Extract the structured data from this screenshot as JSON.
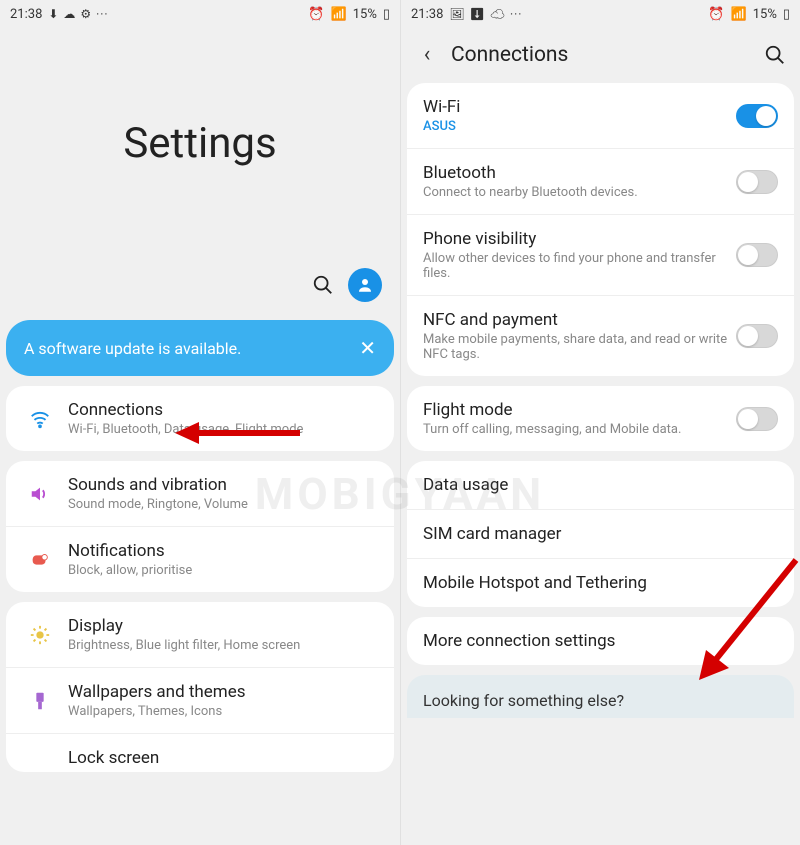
{
  "status": {
    "time": "21:38",
    "battery": "15%",
    "left_icons": "⬇ ☁ ⚙ ···",
    "right_icons_alarm": "⏰",
    "right_icons_wifi_sig": "📶"
  },
  "left": {
    "hero": "Settings",
    "banner": "A software update is available.",
    "items": [
      {
        "title": "Connections",
        "sub": "Wi-Fi, Bluetooth, Data usage, Flight mode"
      },
      {
        "title": "Sounds and vibration",
        "sub": "Sound mode, Ringtone, Volume"
      },
      {
        "title": "Notifications",
        "sub": "Block, allow, prioritise"
      },
      {
        "title": "Display",
        "sub": "Brightness, Blue light filter, Home screen"
      },
      {
        "title": "Wallpapers and themes",
        "sub": "Wallpapers, Themes, Icons"
      },
      {
        "title": "Lock screen",
        "sub": ""
      }
    ]
  },
  "right": {
    "title": "Connections",
    "rows1": [
      {
        "title": "Wi-Fi",
        "sub": "ASUS",
        "blue": true,
        "toggle": "on"
      },
      {
        "title": "Bluetooth",
        "sub": "Connect to nearby Bluetooth devices.",
        "toggle": "off"
      },
      {
        "title": "Phone visibility",
        "sub": "Allow other devices to find your phone and transfer files.",
        "toggle": "off"
      },
      {
        "title": "NFC and payment",
        "sub": "Make mobile payments, share data, and read or write NFC tags.",
        "toggle": "off"
      }
    ],
    "rows2": [
      {
        "title": "Flight mode",
        "sub": "Turn off calling, messaging, and Mobile data.",
        "toggle": "off"
      }
    ],
    "rows3": [
      {
        "title": "Data usage"
      },
      {
        "title": "SIM card manager"
      },
      {
        "title": "Mobile Hotspot and Tethering"
      }
    ],
    "rows4": [
      {
        "title": "More connection settings"
      }
    ],
    "footer": "Looking for something else?"
  },
  "watermark": "MOBIGYAAN"
}
